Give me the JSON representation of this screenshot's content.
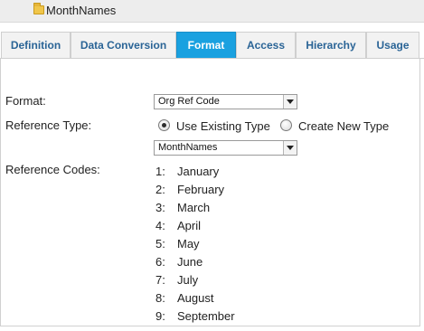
{
  "header": {
    "title": "MonthNames",
    "icon": "folder-icon"
  },
  "tabs": [
    {
      "label": "Definition",
      "active": false
    },
    {
      "label": "Data Conversion",
      "active": false
    },
    {
      "label": "Format",
      "active": true
    },
    {
      "label": "Access",
      "active": false
    },
    {
      "label": "Hierarchy",
      "active": false
    },
    {
      "label": "Usage",
      "active": false
    }
  ],
  "form": {
    "format_label": "Format:",
    "format_value": "Org Ref Code",
    "reference_type_label": "Reference Type:",
    "radio_existing_label": "Use Existing Type",
    "radio_new_label": "Create New Type",
    "radio_selected": "existing",
    "type_select_value": "MonthNames",
    "reference_codes_label": "Reference Codes:"
  },
  "reference_codes": [
    {
      "num": "1:",
      "name": "January"
    },
    {
      "num": "2:",
      "name": "February"
    },
    {
      "num": "3:",
      "name": "March"
    },
    {
      "num": "4:",
      "name": "April"
    },
    {
      "num": "5:",
      "name": "May"
    },
    {
      "num": "6:",
      "name": "June"
    },
    {
      "num": "7:",
      "name": "July"
    },
    {
      "num": "8:",
      "name": "August"
    },
    {
      "num": "9:",
      "name": "September"
    }
  ],
  "colors": {
    "active_tab": "#1aa1e0",
    "tab_text": "#2a6496"
  }
}
